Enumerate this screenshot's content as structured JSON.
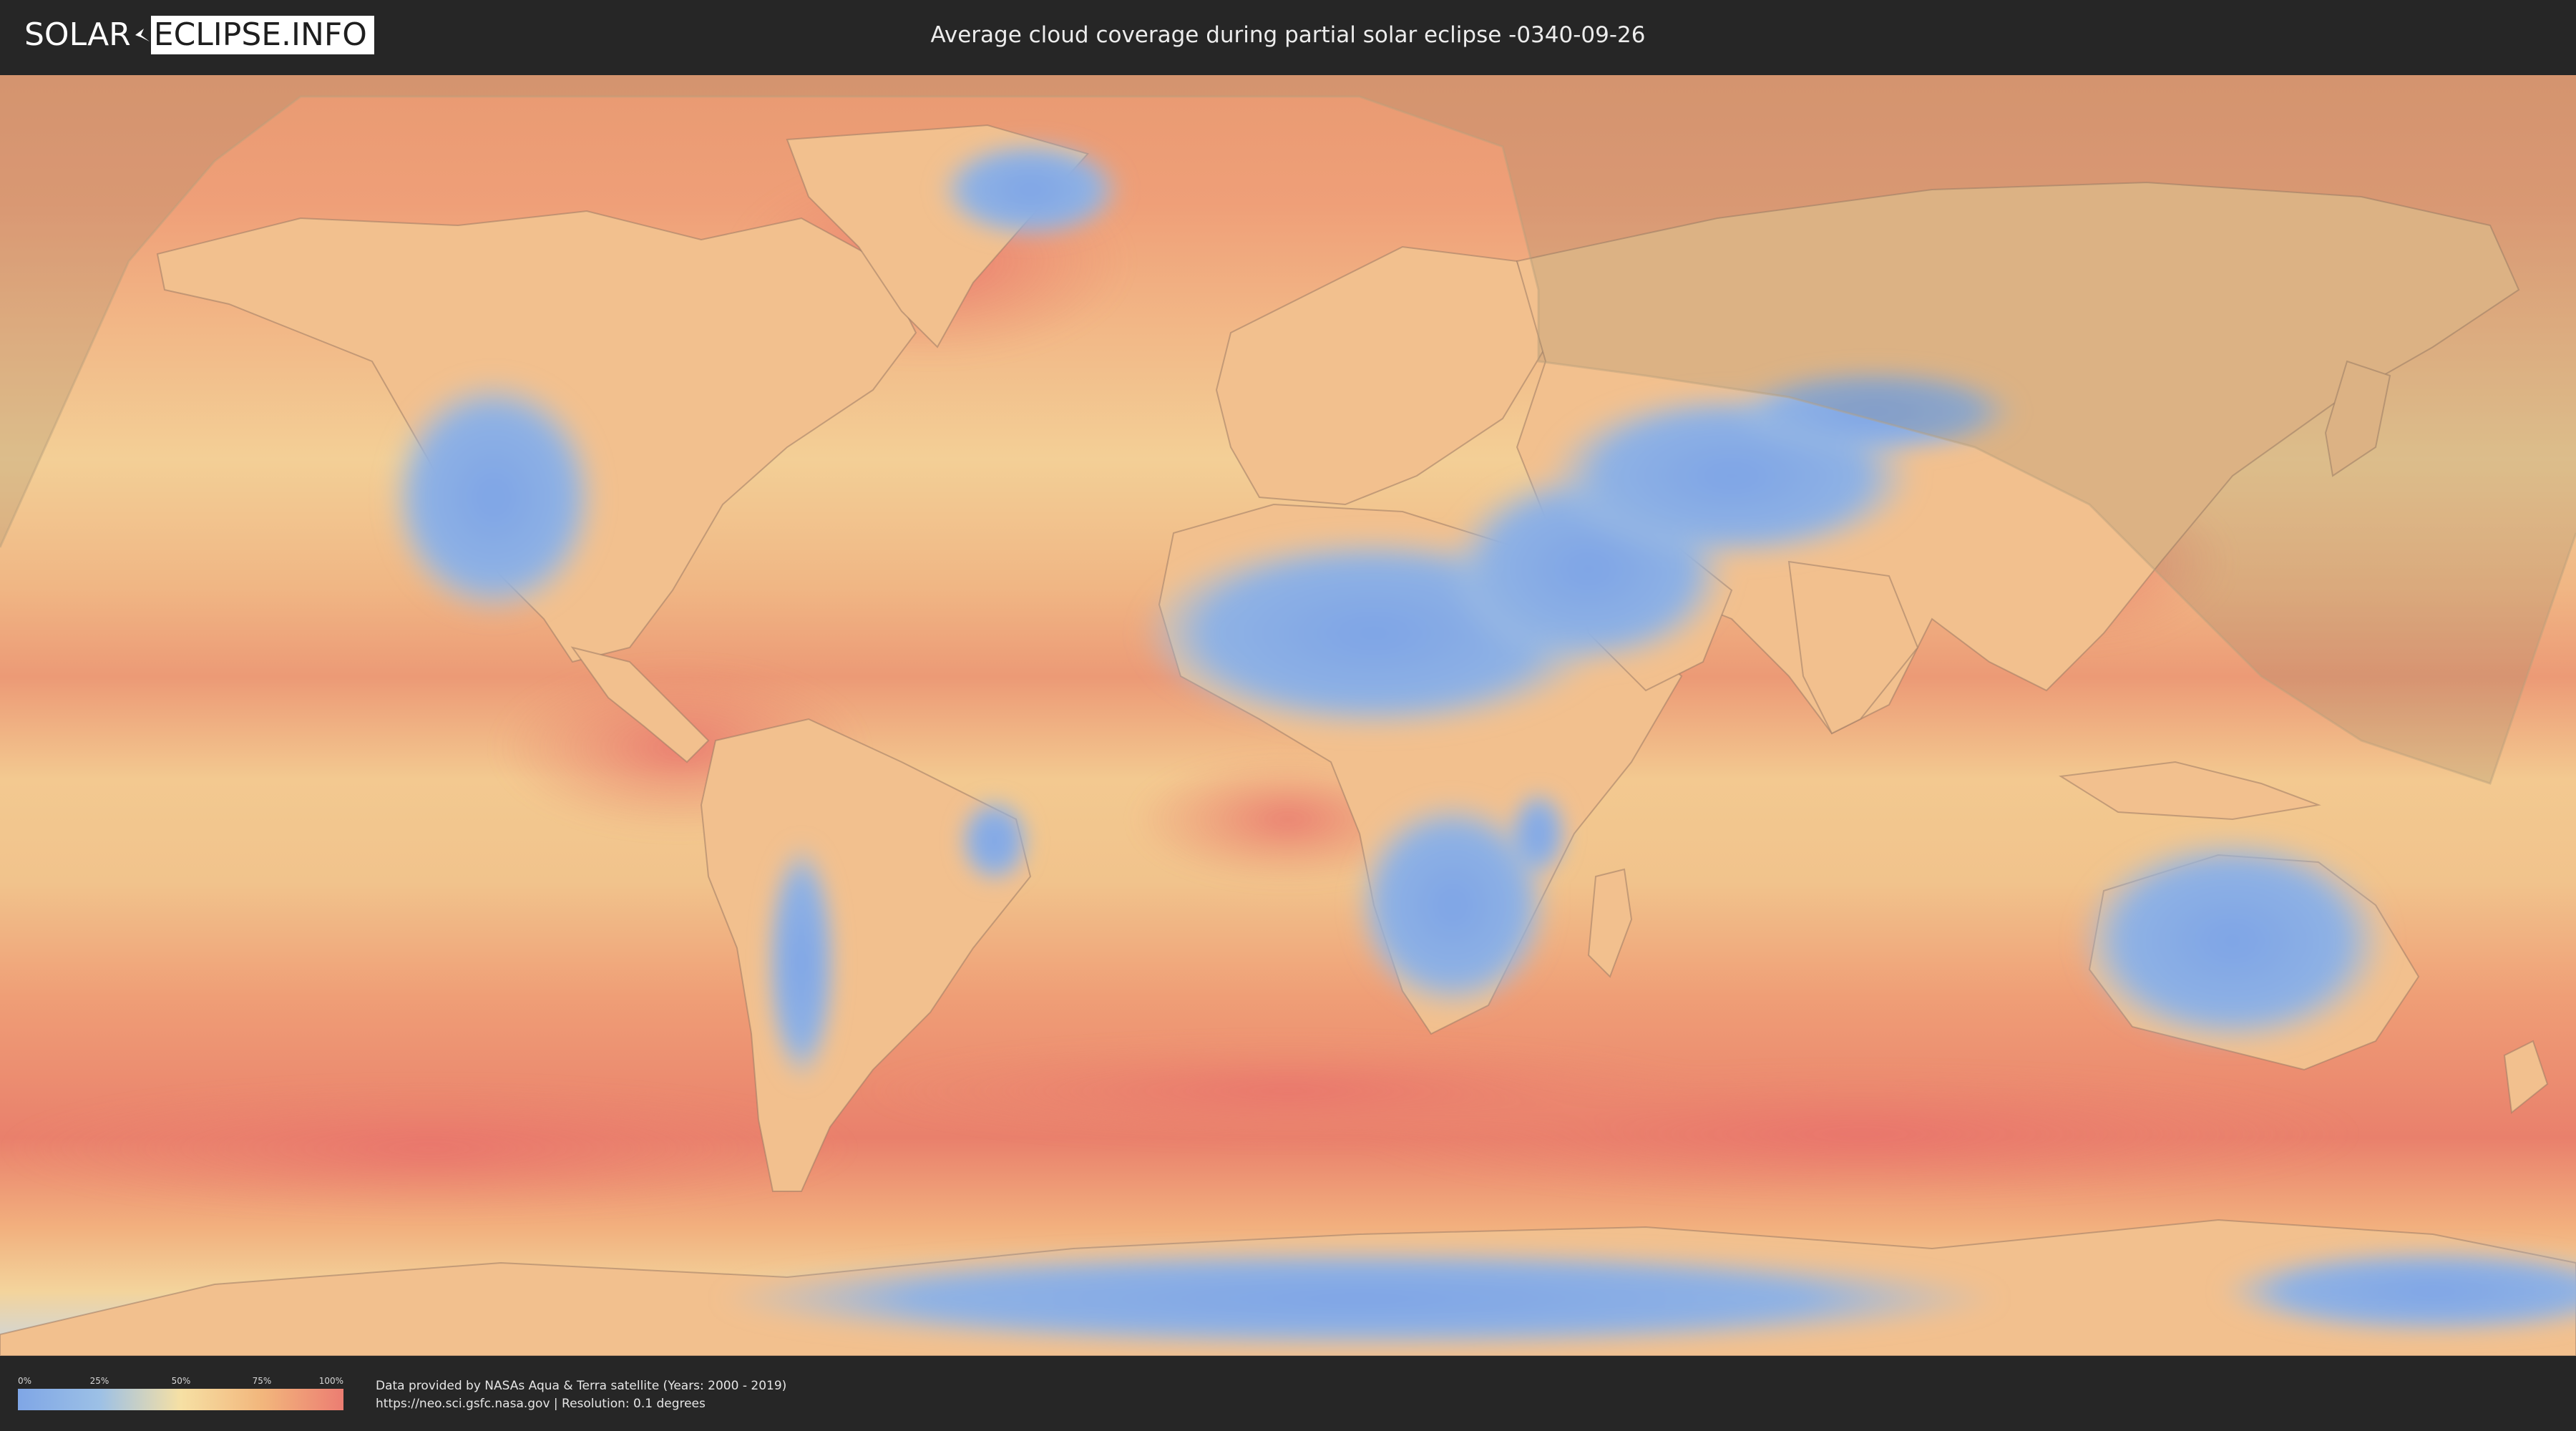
{
  "header": {
    "logo_left": "SOLAR",
    "logo_right": "ECLIPSE.INFO",
    "title": "Average cloud coverage during partial solar eclipse -0340-09-26"
  },
  "map": {
    "variable": "cloud-coverage",
    "projection": "equirectangular-world",
    "overlay": "eclipse-visibility-zone",
    "colors": {
      "clear": "#7fa6e6",
      "low": "#9cc0e6",
      "mid": "#f6e0a4",
      "high": "#f2b67c",
      "overcast": "#ec7d72",
      "overlay": "#a89470"
    }
  },
  "legend": {
    "ticks": [
      "0%",
      "25%",
      "50%",
      "75%",
      "100%"
    ]
  },
  "credits": {
    "line1": "Data provided by NASAs Aqua & Terra satellite (Years: 2000 - 2019)",
    "line2": "https://neo.sci.gsfc.nasa.gov | Resolution: 0.1 degrees"
  }
}
